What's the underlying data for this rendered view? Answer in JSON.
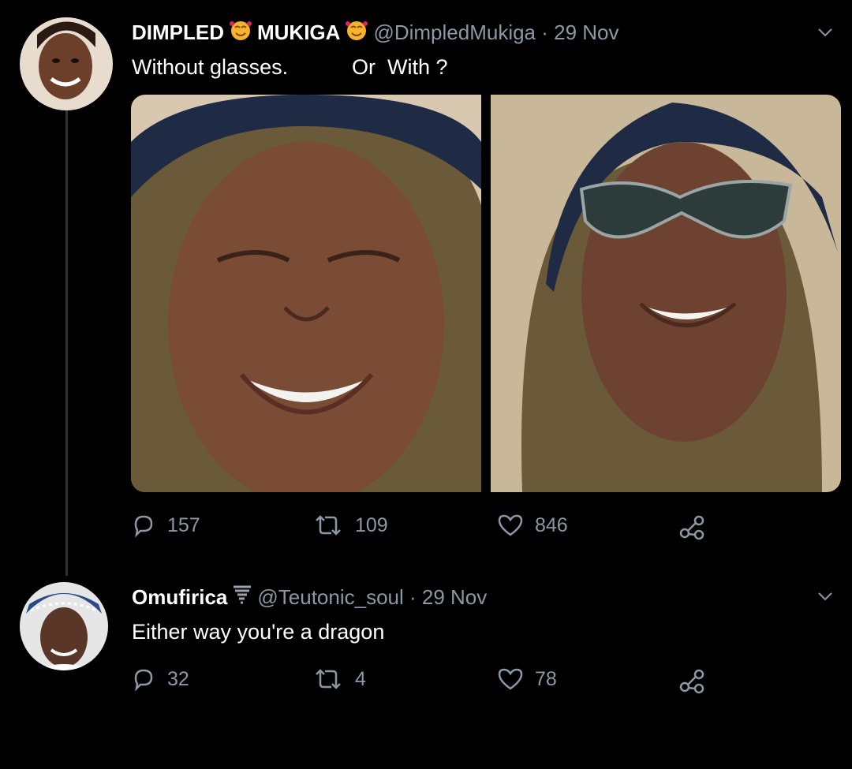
{
  "tweet1": {
    "display_name_1": "DIMPLED",
    "display_name_2": "MUKIGA",
    "handle_date": "@DimpledMukiga · 29 Nov",
    "text_a": "Without glasses.",
    "text_b": "Or  With ?",
    "replies": "157",
    "retweets": "109",
    "likes": "846"
  },
  "tweet2": {
    "display_name": "Omufirica",
    "handle_date": "@Teutonic_soul · 29 Nov",
    "text": "Either way you're a dragon",
    "replies": "32",
    "retweets": "4",
    "likes": "78"
  },
  "colors": {
    "background": "#000000",
    "muted": "#8b98a5",
    "line": "#2f3336"
  }
}
